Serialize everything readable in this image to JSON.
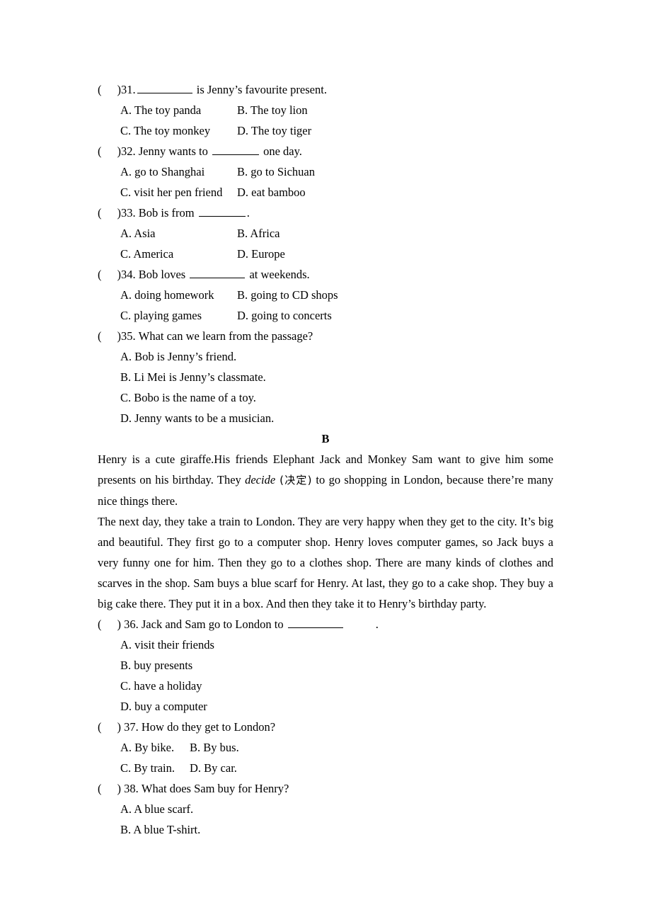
{
  "document": {
    "section_label": "B",
    "questions": [
      {
        "id": "q31",
        "marker_open": "(",
        "marker_close": ")",
        "number": "31.",
        "stem_before": "",
        "blank": true,
        "stem_after": " is Jenny’s favourite present.",
        "layout": "wide",
        "options": [
          {
            "key": "A.",
            "text": "The toy panda"
          },
          {
            "key": "B.",
            "text": "The toy lion"
          },
          {
            "key": "C.",
            "text": "The toy monkey"
          },
          {
            "key": "D.",
            "text": "The toy tiger"
          }
        ]
      },
      {
        "id": "q32",
        "marker_open": "(",
        "marker_close": ")",
        "number": "32.",
        "stem_before": "Jenny wants to ",
        "blank": true,
        "stem_after": " one day.",
        "layout": "wide",
        "options": [
          {
            "key": "A.",
            "text": "go to Shanghai"
          },
          {
            "key": "B.",
            "text": "go to Sichuan"
          },
          {
            "key": "C.",
            "text": "visit her pen friend"
          },
          {
            "key": "D.",
            "text": "eat bamboo"
          }
        ]
      },
      {
        "id": "q33",
        "marker_open": "(",
        "marker_close": ")",
        "number": "33.",
        "stem_before": "Bob is from ",
        "blank": true,
        "stem_after": ".",
        "layout": "wide",
        "options": [
          {
            "key": "A.",
            "text": "Asia"
          },
          {
            "key": "B.",
            "text": "Africa"
          },
          {
            "key": "C.",
            "text": "America"
          },
          {
            "key": "D.",
            "text": "Europe"
          }
        ]
      },
      {
        "id": "q34",
        "marker_open": "(",
        "marker_close": ")",
        "number": "34.",
        "stem_before": "Bob loves ",
        "blank": true,
        "stem_after": " at weekends.",
        "layout": "wide",
        "options": [
          {
            "key": "A.",
            "text": "doing homework"
          },
          {
            "key": "B.",
            "text": "going to CD shops"
          },
          {
            "key": "C.",
            "text": "playing games"
          },
          {
            "key": "D.",
            "text": "going to concerts"
          }
        ]
      },
      {
        "id": "q35",
        "marker_open": "(",
        "marker_close": ")",
        "number": "35.",
        "stem_before": "What can we learn from the passage?",
        "blank": false,
        "stem_after": "",
        "layout": "stacked",
        "options": [
          {
            "key": "A.",
            "text": "Bob is Jenny’s friend."
          },
          {
            "key": "B.",
            "text": "Li Mei is Jenny’s classmate."
          },
          {
            "key": "C.",
            "text": "Bobo is the name of a toy."
          },
          {
            "key": "D.",
            "text": "Jenny wants to be a musician."
          }
        ]
      },
      {
        "id": "q36",
        "marker_open": "(",
        "marker_close": ")",
        "number": "36.",
        "stem_before": "Jack and Sam go to London to ",
        "blank": true,
        "stem_after": ".",
        "layout": "stacked",
        "trailing_gap": true,
        "options": [
          {
            "key": "A.",
            "text": "visit their friends"
          },
          {
            "key": "B.",
            "text": "buy presents"
          },
          {
            "key": "C.",
            "text": "have a holiday"
          },
          {
            "key": "D.",
            "text": "buy a computer"
          }
        ]
      },
      {
        "id": "q37",
        "marker_open": "(",
        "marker_close": ")",
        "number": "37.",
        "stem_before": "How do they get to London?",
        "blank": false,
        "stem_after": "",
        "layout": "narrow",
        "options": [
          {
            "key": "A.",
            "text": "By bike."
          },
          {
            "key": "B.",
            "text": "By bus."
          },
          {
            "key": "C.",
            "text": "By train."
          },
          {
            "key": "D.",
            "text": "By car."
          }
        ]
      },
      {
        "id": "q38",
        "marker_open": "(",
        "marker_close": ")",
        "number": "38.",
        "stem_before": "What does Sam buy for Henry?",
        "blank": false,
        "stem_after": "",
        "layout": "stacked",
        "options": [
          {
            "key": "A.",
            "text": "A blue scarf."
          },
          {
            "key": "B.",
            "text": "A blue T-shirt."
          }
        ]
      }
    ],
    "passage": {
      "paragraph1_part1": "Henry is a cute giraffe.His friends Elephant Jack and Monkey Sam want to give him some presents on his birthday. They ",
      "paragraph1_italic": "decide",
      "paragraph1_gloss": " (决定) ",
      "paragraph1_part2": "to go shopping in London, because there’re many nice things there.",
      "paragraph2": "The next day, they take a train to London. They are very happy when they get to the city. It’s big and beautiful. They first go to a computer shop. Henry loves computer games, so Jack buys a very funny one for him. Then they go to a clothes shop. There are many kinds of clothes and scarves in the shop. Sam buys a blue scarf for Henry. At last, they go to a cake shop. They buy a big cake there. They put it in a box. And then they take it to Henry’s birthday party."
    }
  }
}
